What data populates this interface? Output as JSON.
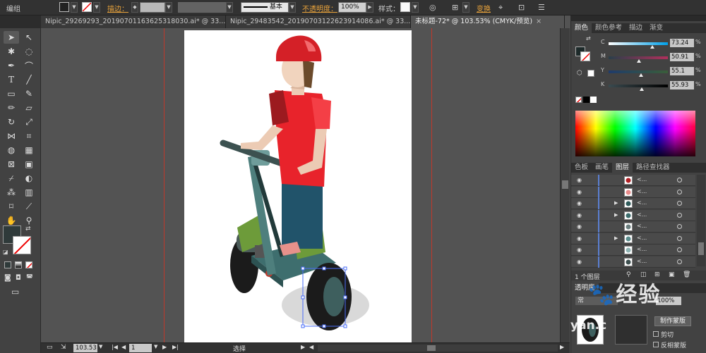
{
  "control_bar": {
    "group_label": "编组",
    "stroke_label": "描边：",
    "stroke_profile": "基本",
    "opacity_label": "不透明度：",
    "opacity_value": "100%",
    "style_label": "样式：",
    "transform_label": "变换"
  },
  "tabs": [
    {
      "label": "Nipic_29269293_20190701163625318030.ai* @ 33...",
      "close": "×"
    },
    {
      "label": "Nipic_29483542_20190703122623914086.ai* @ 33...",
      "close": "×"
    },
    {
      "label": "未标题-72* @ 103.53% (CMYK/预览)",
      "close": "×"
    }
  ],
  "status": {
    "zoom": "103.53",
    "page": "1",
    "tool_name": "选择"
  },
  "color_panel": {
    "tabs": [
      "颜色",
      "颜色参考",
      "描边",
      "渐变"
    ],
    "channels": [
      {
        "letter": "C",
        "value": "73.24",
        "fraction": 0.7324,
        "gradient": "linear-gradient(to right,#ffffff,#00a0e9)"
      },
      {
        "letter": "M",
        "value": "50.91",
        "fraction": 0.5091,
        "gradient": "linear-gradient(to right,#2a3f4a,#b0305c)"
      },
      {
        "letter": "Y",
        "value": "55.1",
        "fraction": 0.551,
        "gradient": "linear-gradient(to right,#1f3b6b,#3a5e3a)"
      },
      {
        "letter": "K",
        "value": "55.93",
        "fraction": 0.5593,
        "gradient": "linear-gradient(to right,#3a4a4f,#000000)"
      }
    ],
    "pct": "%"
  },
  "layers_panel": {
    "tabs": [
      "色板",
      "画笔",
      "图层",
      "路径查找器"
    ],
    "rows": [
      {
        "name": "<...",
        "expand": "",
        "thumb": "#b01f24"
      },
      {
        "name": "<...",
        "expand": "",
        "thumb": "#e88a8a"
      },
      {
        "name": "<...",
        "expand": "▶",
        "thumb": "#2e5a5a"
      },
      {
        "name": "<...",
        "expand": "▶",
        "thumb": "#3c6d6d"
      },
      {
        "name": "<...",
        "expand": "",
        "thumb": "#6b7f7f"
      },
      {
        "name": "<...",
        "expand": "▶",
        "thumb": "#5a8c8c"
      },
      {
        "name": "<...",
        "expand": "",
        "thumb": "#8fb3b3"
      },
      {
        "name": "<...",
        "expand": "",
        "thumb": "#3d4f4f"
      }
    ],
    "footer_count": "1 个图层"
  },
  "transparency_panel": {
    "tab": "透明度",
    "mode": "常",
    "opacity": "100%",
    "make_mask": "制作蒙版",
    "clip": "剪切",
    "invert_mask": "反相蒙版"
  },
  "watermark": {
    "brand": "经验",
    "url": "yan.c"
  },
  "colors": {
    "accent_orange": "#e9a33b",
    "helmet": "#d42027",
    "shirt": "#e8232b",
    "pants": "#21536a",
    "scooter_green": "#6d9b3a",
    "tire": "#1b1b1b"
  }
}
